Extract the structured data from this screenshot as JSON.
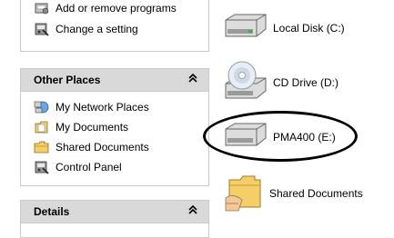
{
  "system_tasks": {
    "items": [
      {
        "label": "Add or remove programs",
        "icon": "add-remove-programs-icon"
      },
      {
        "label": "Change a setting",
        "icon": "control-panel-icon"
      }
    ]
  },
  "other_places": {
    "title": "Other Places",
    "collapse_glyph": "⌃⌃",
    "items": [
      {
        "label": "My Network Places",
        "icon": "network-places-icon"
      },
      {
        "label": "My Documents",
        "icon": "my-documents-icon"
      },
      {
        "label": "Shared Documents",
        "icon": "folder-icon"
      },
      {
        "label": "Control Panel",
        "icon": "control-panel-icon"
      }
    ]
  },
  "details": {
    "title": "Details",
    "collapse_glyph": "⌃⌃"
  },
  "drives": [
    {
      "label": "Local Disk (C:)",
      "icon": "hard-disk-icon"
    },
    {
      "label": "CD Drive (D:)",
      "icon": "cd-drive-icon"
    },
    {
      "label": "PMA400 (E:)",
      "icon": "removable-drive-icon"
    },
    {
      "label": "Shared Documents",
      "icon": "shared-folder-icon"
    }
  ],
  "colors": {
    "header_bg": "#d9d9d9",
    "pane_border": "#c9c9c9",
    "highlight_oval": "#000000"
  }
}
